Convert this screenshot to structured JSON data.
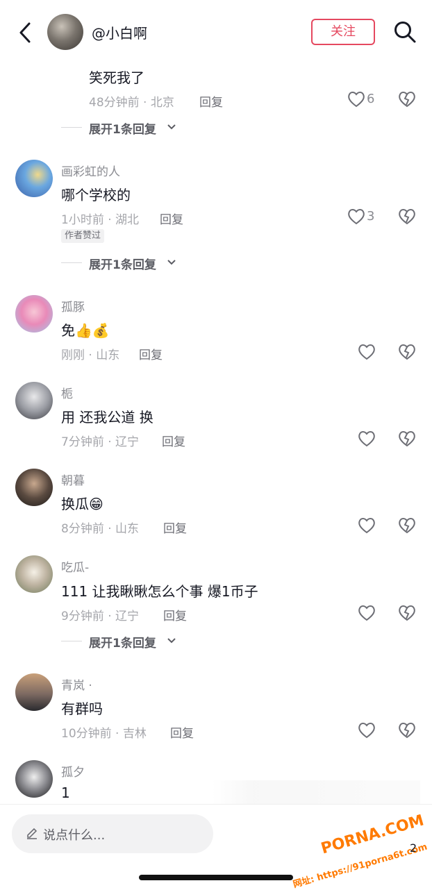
{
  "header": {
    "username": "@小白啊",
    "follow_label": "关注"
  },
  "comments": [
    {
      "text": "笑死我了",
      "meta": "48分钟前 · 北京",
      "reply": "回复",
      "likes": "6",
      "expand": "展开1条回复"
    },
    {
      "nick": "画彩虹的人",
      "text": "哪个学校的",
      "meta": "1小时前 · 湖北",
      "reply": "回复",
      "likes": "3",
      "badge": "作者赞过",
      "expand": "展开1条回复"
    },
    {
      "nick": "孤豚",
      "text": "免",
      "emoji": "👍💰",
      "meta": "刚刚 · 山东",
      "reply": "回复"
    },
    {
      "nick": "栀",
      "text": "用 还我公道 换",
      "meta": "7分钟前 · 辽宁",
      "reply": "回复"
    },
    {
      "nick": "朝暮",
      "text": "换瓜",
      "emoji": "😁",
      "meta": "8分钟前 · 山东",
      "reply": "回复"
    },
    {
      "nick": "吃瓜-",
      "text": "111 让我瞅瞅怎么个事 爆1币子",
      "meta": "9分钟前 · 辽宁",
      "reply": "回复",
      "expand": "展开1条回复"
    },
    {
      "nick": "青岚 ·",
      "text": "有群吗",
      "meta": "10分钟前 · 吉林",
      "reply": "回复"
    },
    {
      "nick": "孤夕",
      "text": "1"
    }
  ],
  "bottom": {
    "placeholder": "说点什么...",
    "count": "2"
  },
  "watermark": {
    "brand": "PORNA.COM",
    "url": "网址: https://91porna6t.com"
  },
  "icons": [
    "back-arrow-icon",
    "search-icon",
    "heart-icon",
    "broken-heart-icon",
    "chevron-down-icon",
    "pen-icon"
  ],
  "colors": {
    "follow": "#e5485f",
    "text": "#161823",
    "meta": "#a5a6ab",
    "watermark": "#ff7a00"
  }
}
